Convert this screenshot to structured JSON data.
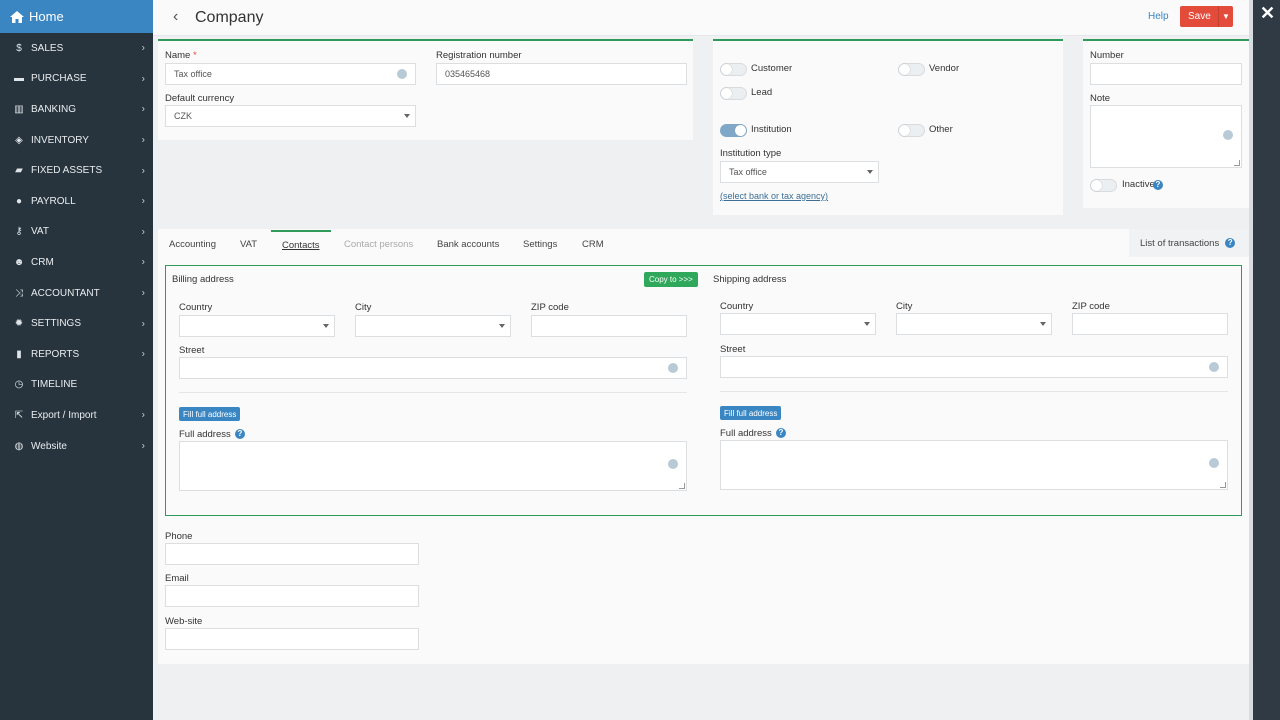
{
  "sidebar": {
    "home": "Home",
    "items": [
      {
        "label": "SALES",
        "icon": "$"
      },
      {
        "label": "PURCHASE",
        "icon": "cart"
      },
      {
        "label": "BANKING",
        "icon": "bank"
      },
      {
        "label": "INVENTORY",
        "icon": "cubes"
      },
      {
        "label": "FIXED ASSETS",
        "icon": "car"
      },
      {
        "label": "PAYROLL",
        "icon": "user"
      },
      {
        "label": "VAT",
        "icon": "key"
      },
      {
        "label": "CRM",
        "icon": "users"
      },
      {
        "label": "ACCOUNTANT",
        "icon": "shuffle"
      },
      {
        "label": "SETTINGS",
        "icon": "gear"
      },
      {
        "label": "REPORTS",
        "icon": "bar-chart"
      },
      {
        "label": "TIMELINE",
        "icon": "clock"
      },
      {
        "label": "Export / Import",
        "icon": "export"
      },
      {
        "label": "Website",
        "icon": "globe"
      }
    ]
  },
  "header": {
    "title": "Company",
    "help": "Help",
    "save": "Save"
  },
  "form": {
    "name_label": "Name",
    "name_value": "Tax office",
    "reg_label": "Registration number",
    "reg_value": "035465468",
    "currency_label": "Default currency",
    "currency_value": "CZK"
  },
  "roles": {
    "customer": "Customer",
    "vendor": "Vendor",
    "lead": "Lead",
    "institution": "Institution",
    "other": "Other",
    "institution_type_label": "Institution type",
    "institution_type_value": "Tax office",
    "select_link": "(select bank or tax agency)"
  },
  "meta": {
    "number_label": "Number",
    "note_label": "Note",
    "inactive_label": "Inactive"
  },
  "tabs": [
    "Accounting",
    "VAT",
    "Contacts",
    "Contact persons",
    "Bank accounts",
    "Settings",
    "CRM"
  ],
  "list_of_transactions": "List of transactions",
  "billing": {
    "title": "Billing address",
    "copy_btn": "Copy to >>>",
    "country": "Country",
    "city": "City",
    "zip": "ZIP code",
    "street": "Street",
    "fill_btn": "Fill full address",
    "full_address": "Full address"
  },
  "shipping": {
    "title": "Shipping address",
    "country": "Country",
    "city": "City",
    "zip": "ZIP code",
    "street": "Street",
    "fill_btn": "Fill full address",
    "full_address": "Full address"
  },
  "contact": {
    "phone": "Phone",
    "email": "Email",
    "website": "Web-site"
  },
  "colors": {
    "accent_green": "#2f9a5a",
    "save_red": "#e34b3a",
    "sidebar_bg": "#27343d",
    "home_blue": "#3a86c2"
  }
}
